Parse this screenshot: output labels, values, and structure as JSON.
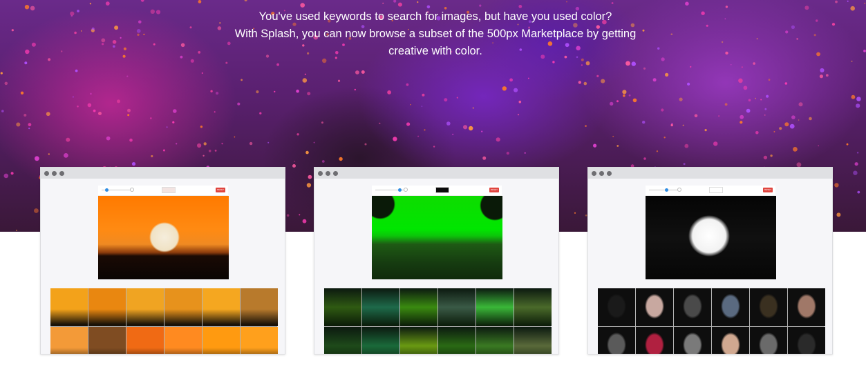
{
  "hero": {
    "line1": "You've used keywords to search for images, but have you used color?",
    "line2": "With Splash, you can now browse a subset of the 500px Marketplace by getting",
    "line3": "creative with color."
  },
  "windows": [
    {
      "theme": "orange-sunset",
      "reset_label": "RESET",
      "swatch_color": "#f3e4e2",
      "tiles": [
        "#f3a21a",
        "#e98710",
        "#f0a422",
        "#e7921c",
        "#f5a720",
        "#b87a2c",
        "#f39a38",
        "#7f4c22",
        "#f06a14",
        "#ff8a20",
        "#ff9a10",
        "#ffa01c"
      ]
    },
    {
      "theme": "green-aurora",
      "reset_label": "RESET",
      "swatch_color": "#0a0a0a",
      "tiles": [
        "#2f5a12",
        "#1e6a4a",
        "#3a8a10",
        "#3a5a46",
        "#3ab838",
        "#4a6a2a",
        "#1e4a1a",
        "#1a6a3a",
        "#6a9a12",
        "#2a6a14",
        "#3a7a22",
        "#5a6a3a"
      ]
    },
    {
      "theme": "black-and-white-portraits",
      "reset_label": "RESET",
      "swatch_color": "#ffffff",
      "tiles": [
        "#1a1a1a",
        "#c8a8a0",
        "#4a4a4a",
        "#5a6a80",
        "#3a3020",
        "#a07868",
        "#5a5a5a",
        "#b02040",
        "#7a7a7a",
        "#d0a890",
        "#6a6a6a",
        "#2a2a2a"
      ]
    }
  ]
}
